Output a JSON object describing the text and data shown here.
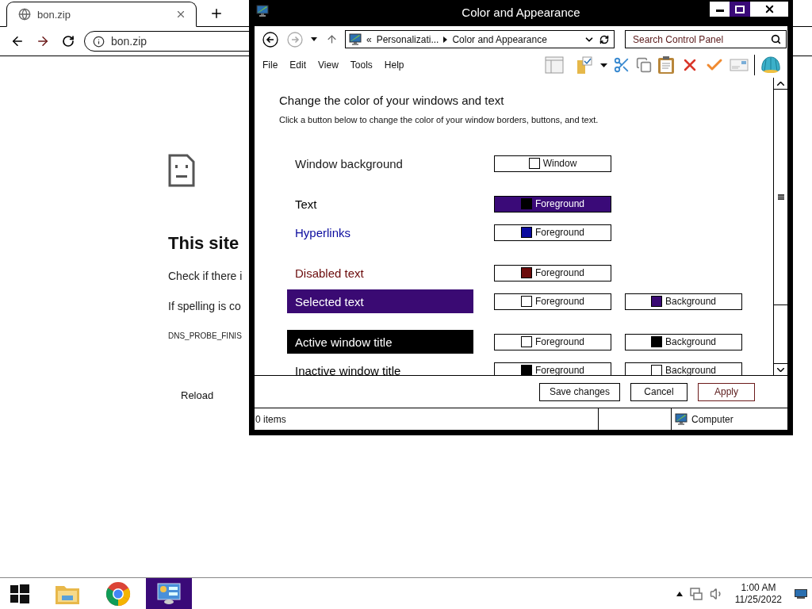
{
  "browser": {
    "tab": {
      "title": "bon.zip"
    },
    "address": "bon.zip",
    "error": {
      "heading": "This site",
      "lines": [
        "Check if there i",
        "If spelling is co"
      ],
      "code": "DNS_PROBE_FINIS",
      "reload": "Reload"
    }
  },
  "window": {
    "title": "Color and Appearance",
    "breadcrumb": {
      "overflow": "«",
      "items": [
        "Personalizati...",
        "Color and Appearance"
      ]
    },
    "search": {
      "placeholder": "Search Control Panel"
    },
    "menu": [
      "File",
      "Edit",
      "View",
      "Tools",
      "Help"
    ],
    "heading": "Change the color of your windows and text",
    "instructions": "Click a button below to change the color of your window borders, buttons, and text.",
    "groups": [
      {
        "rows": [
          {
            "label": "Window background",
            "kind": "window",
            "buttons": [
              {
                "label": "Window",
                "color": "#ffffff",
                "selected": false
              }
            ]
          }
        ]
      },
      {
        "rows": [
          {
            "label": "Text",
            "kind": "element",
            "buttons": [
              {
                "label": "Foreground",
                "color": "#000000",
                "selected": true
              }
            ]
          },
          {
            "label": "Hyperlinks",
            "kind": "element",
            "buttons": [
              {
                "label": "Foreground",
                "color": "#0a0a9e",
                "selected": false
              }
            ]
          }
        ]
      },
      {
        "rows": [
          {
            "label": "Disabled text",
            "kind": "element",
            "buttons": [
              {
                "label": "Foreground",
                "color": "#6b0b0b",
                "selected": false
              }
            ]
          },
          {
            "label": "Selected text",
            "kind": "element",
            "buttons": [
              {
                "label": "Foreground",
                "color": "#ffffff",
                "selected": false
              },
              {
                "label": "Background",
                "color": "#3a0a73",
                "selected": false
              }
            ]
          }
        ]
      },
      {
        "rows": [
          {
            "label": "Active window title",
            "kind": "element",
            "buttons": [
              {
                "label": "Foreground",
                "color": "#ffffff",
                "selected": false
              },
              {
                "label": "Background",
                "color": "#000000",
                "selected": false
              }
            ]
          },
          {
            "label": "Inactive window title",
            "kind": "element",
            "buttons": [
              {
                "label": "Foreground",
                "color": "#000000",
                "selected": false
              },
              {
                "label": "Background",
                "color": "#ffffff",
                "selected": false
              }
            ]
          }
        ]
      }
    ],
    "buttons": [
      {
        "label": "Save changes",
        "default": false
      },
      {
        "label": "Cancel",
        "default": false
      },
      {
        "label": "Apply",
        "default": true
      }
    ],
    "status_bar": {
      "count": "0 items",
      "location": "Computer"
    }
  },
  "taskbar": {
    "apps": [
      {
        "kind": "explorer",
        "selected": false
      },
      {
        "kind": "chrome",
        "selected": false
      },
      {
        "kind": "control_panel",
        "selected": true
      }
    ],
    "clock": {
      "time": "1:00 AM",
      "date": "11/25/2022"
    }
  }
}
